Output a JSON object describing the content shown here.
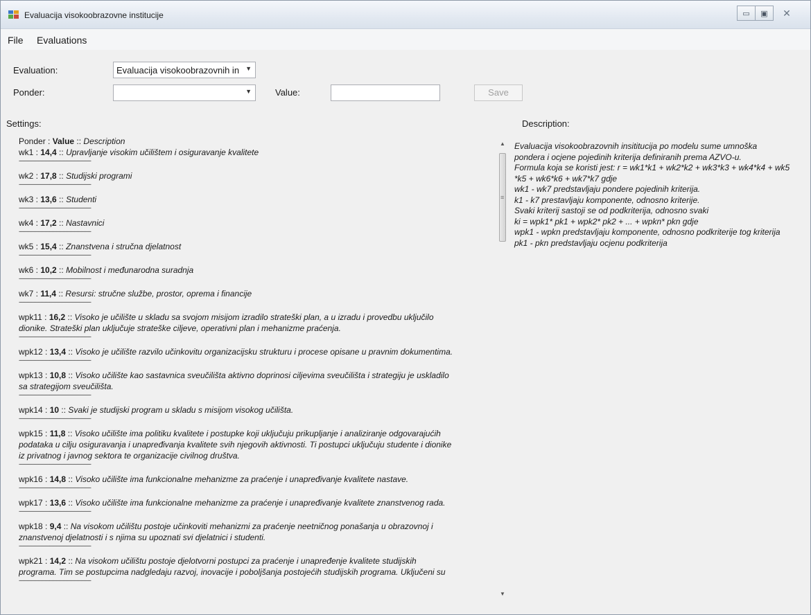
{
  "window": {
    "title": "Evaluacija visokoobrazovne institucije",
    "controls": {
      "minimize": "▭",
      "maximize": "▣",
      "close": "✕"
    }
  },
  "menu": {
    "file": "File",
    "evaluations": "Evaluations"
  },
  "form": {
    "evaluation_label": "Evaluation:",
    "evaluation_value": "Evaluacija visokoobrazovnih in",
    "ponder_label": "Ponder:",
    "ponder_value": "",
    "value_label": "Value:",
    "value_value": "",
    "save_label": "Save"
  },
  "settings": {
    "title": "Settings:",
    "header": {
      "ponder": "Ponder",
      "colon": " : ",
      "value": "Value",
      "sep": " :: ",
      "description": "Description"
    },
    "separator": "----------------------------------------------------",
    "entries": [
      {
        "code": "wk1",
        "value": "14,4",
        "lines": [
          "Upravljanje visokim učilištem i osiguravanje kvalitete"
        ]
      },
      {
        "code": "wk2",
        "value": "17,8",
        "lines": [
          "Studijski programi"
        ]
      },
      {
        "code": "wk3",
        "value": "13,6",
        "lines": [
          "Studenti"
        ]
      },
      {
        "code": "wk4",
        "value": "17,2",
        "lines": [
          "Nastavnici"
        ]
      },
      {
        "code": "wk5",
        "value": "15,4",
        "lines": [
          "Znanstvena i stručna djelatnost"
        ]
      },
      {
        "code": "wk6",
        "value": "10,2",
        "lines": [
          "Mobilnost i međunarodna suradnja"
        ]
      },
      {
        "code": "wk7",
        "value": "11,4",
        "lines": [
          "Resursi: stručne službe, prostor, oprema i financije"
        ]
      },
      {
        "code": "wpk11",
        "value": "16,2",
        "lines": [
          "Visoko je učilište u skladu sa svojom misijom izradilo strateški plan, a u izradu i provedbu uključilo",
          "dionike. Strateški plan uključuje strateške ciljeve, operativni plan i mehanizme praćenja."
        ]
      },
      {
        "code": "wpk12",
        "value": "13,4",
        "lines": [
          "Visoko je učilište razvilo učinkovitu organizacijsku strukturu i procese opisane u pravnim dokumentima."
        ]
      },
      {
        "code": "wpk13",
        "value": "10,8",
        "lines": [
          "Visoko učilište kao sastavnica sveučilišta aktivno doprinosi ciljevima sveučilišta i strategiju je uskladilo",
          "sa strategijom sveučilišta."
        ]
      },
      {
        "code": "wpk14",
        "value": "10",
        "lines": [
          "Svaki je studijski program u skladu s misijom visokog učilišta."
        ]
      },
      {
        "code": "wpk15",
        "value": "11,8",
        "lines": [
          "Visoko učilište ima politiku kvalitete i postupke koji uključuju prikupljanje i analiziranje odgovarajućih",
          "podataka u cilju osiguravanja i unapređivanja kvalitete svih njegovih aktivnosti. Ti postupci uključuju studente i dionike",
          "iz privatnog i javnog sektora te organizacije civilnog društva."
        ]
      },
      {
        "code": "wpk16",
        "value": "14,8",
        "lines": [
          "Visoko učilište ima funkcionalne mehanizme za praćenje i unapređivanje kvalitete nastave."
        ]
      },
      {
        "code": "wpk17",
        "value": "13,6",
        "lines": [
          "Visoko učilište ima funkcionalne mehanizme za praćenje i unapređivanje kvalitete znanstvenog rada."
        ]
      },
      {
        "code": "wpk18",
        "value": "9,4",
        "lines": [
          "Na visokom učilištu postoje učinkoviti mehanizmi za praćenje neetničnog ponašanja u obrazovnoj i",
          "znanstvenoj djelatnosti i s njima su upoznati svi djelatnici i studenti."
        ]
      },
      {
        "code": "wpk21",
        "value": "14,2",
        "lines": [
          "Na visokom učilištu postoje djelotvorni postupci za praćenje i unapređenje kvalitete studijskih",
          "programa. Tim se postupcima nadgledaju razvoj, inovacije i poboljšanja postojećih studijskih programa. Uključeni su"
        ]
      }
    ]
  },
  "description": {
    "title": "Description:",
    "lines": [
      "Evaluacija visokoobrazovnih insititucija po modelu sume umnoška",
      "pondera i ocjene pojedinih kriterija definiranih prema AZVO-u.",
      "Formula koja se koristi jest: r = wk1*k1 + wk2*k2 + wk3*k3 + wk4*k4 + wk5",
      "*k5 + wk6*k6 + wk7*k7 gdje",
      "wk1 - wk7 predstavljaju pondere pojedinih kriterija.",
      "k1 - k7 prestavljaju komponente, odnosno kriterije.",
      "Svaki kriterij sastoji se od podkriterija, odnosno svaki",
      "ki = wpk1* pk1 + wpk2* pk2 + ... + wpkn* pkn gdje",
      "wpk1 - wpkn predstavljaju komponente, odnosno podkriterije tog kriterija",
      "pk1 - pkn predstavljaju ocjenu podkriterija"
    ]
  }
}
